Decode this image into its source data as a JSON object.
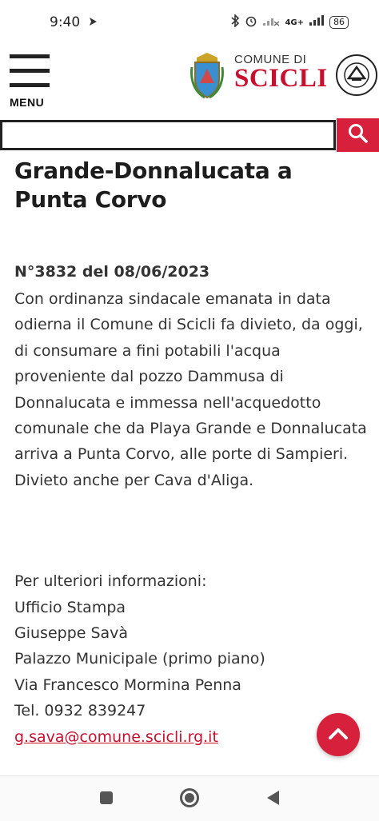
{
  "status_bar": {
    "time": "9:40",
    "network": "4G+",
    "battery": "86"
  },
  "header": {
    "menu_label": "MENU",
    "logo_small": "COMUNE DI",
    "logo_big": "SCICLI"
  },
  "search": {
    "value": "",
    "placeholder": ""
  },
  "article": {
    "title": "Grande-Donnalucata a Punta Corvo",
    "ordinance": "N°3832 del 08/06/2023",
    "paragraphs": [
      "Con ordinanza sindacale emanata in data odierna il Comune di Scicli fa divieto, da oggi, di consumare a fini potabili l'acqua proveniente dal pozzo Dammusa di Donnalucata e immessa nell'acquedotto comunale che da Playa Grande e Donnalucata arriva a Punta Corvo, alle porte di Sampieri.",
      "Divieto anche per Cava d'Aliga."
    ],
    "info_lines": [
      "Per ulteriori informazioni:",
      "Ufficio Stampa",
      "Giuseppe Savà",
      "Palazzo Municipale (primo piano)",
      "Via Francesco Mormina Penna",
      "Tel. 0932 839247"
    ],
    "email": "g.sava@comune.scicli.rg.it"
  },
  "colors": {
    "accent": "#d7213c",
    "logo_red": "#c8102e",
    "text": "#333333"
  },
  "icons": {
    "menu": "hamburger-icon",
    "search": "search-icon",
    "scroll_top": "chevron-up-icon",
    "nav_recents": "square-icon",
    "nav_home": "circle-icon",
    "nav_back": "triangle-back-icon"
  }
}
